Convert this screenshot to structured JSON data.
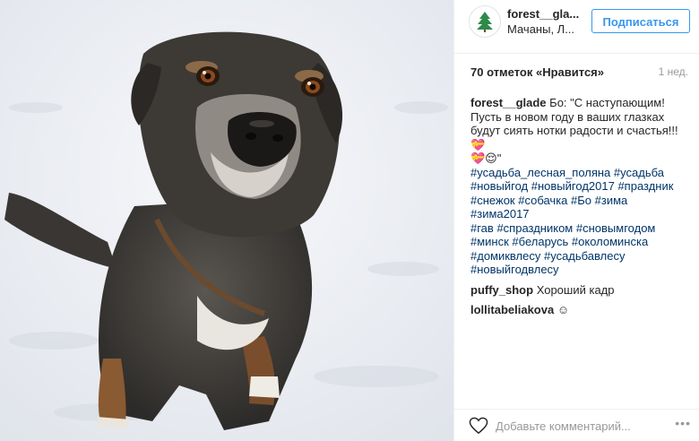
{
  "post": {
    "image_alt_icon": "dog-photo",
    "header": {
      "username": "forest__gla...",
      "location": "Мачаны, Л...",
      "follow_label": "Подписаться"
    },
    "likes_text": "70 отметок «Нравится»",
    "time_ago": "1 нед.",
    "caption": {
      "author": "forest__glade",
      "lines": [
        "Бо: \"С наступающим!",
        "Пусть в новом году в ваших глазках",
        "будут сиять нотки радости и счастья!!!💝",
        "💝😌\""
      ],
      "tag_lines": [
        [
          "#усадьба_лесная_поляна",
          "#усадьба"
        ],
        [
          "#новыйгод",
          "#новыйгод2017",
          "#праздник"
        ],
        [
          "#снежок",
          "#собачка",
          "#Бо",
          "#зима",
          "#зима2017"
        ],
        [
          "#гав",
          "#спраздником",
          "#сновымгодом"
        ],
        [
          "#минск",
          "#беларусь",
          "#околоминска"
        ],
        [
          "#домиквлесу",
          "#усадьбавлесу"
        ],
        [
          "#новыйгодвлесу"
        ]
      ]
    },
    "comments": [
      {
        "author": "puffy_shop",
        "text": "Хороший кадр"
      },
      {
        "author": "lollitabeliakova",
        "text": "☺"
      }
    ],
    "comment_placeholder": "Добавьте комментарий...",
    "more_label": "•••"
  },
  "colors": {
    "accent": "#3897f0",
    "hashtag": "#003569",
    "muted": "#999999"
  }
}
